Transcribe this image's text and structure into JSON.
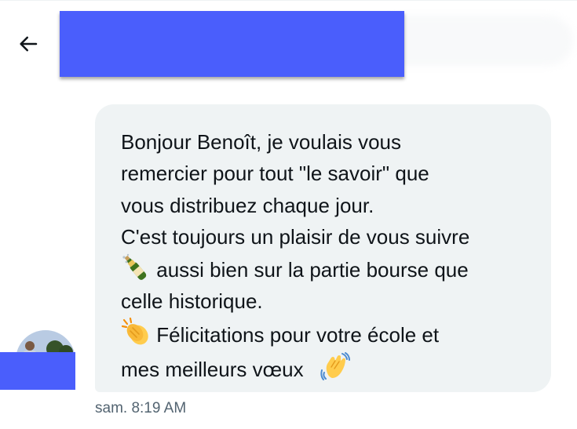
{
  "header": {
    "back_icon": "arrow-left-icon"
  },
  "message": {
    "lines": [
      "Bonjour Benoît, je voulais vous",
      "remercier pour tout \"le savoir\" que",
      "vous distribuez chaque jour.",
      "C'est toujours un plaisir de vous suivre",
      "aussi bien sur la partie bourse que",
      "celle historique.",
      "Félicitations pour votre école et",
      "mes meilleurs vœux"
    ],
    "emojis": [
      "champagne-bottle-icon",
      "clapping-hands-icon",
      "waving-hand-icon"
    ],
    "timestamp": "sam. 8:19 AM"
  },
  "colors": {
    "bubble_bg": "#eff3f4",
    "text": "#0f1419",
    "timestamp": "#536471",
    "redaction": "#4a5efc",
    "clap_yellow": "#ffcc4d",
    "champagne_green": "#3e721d"
  }
}
